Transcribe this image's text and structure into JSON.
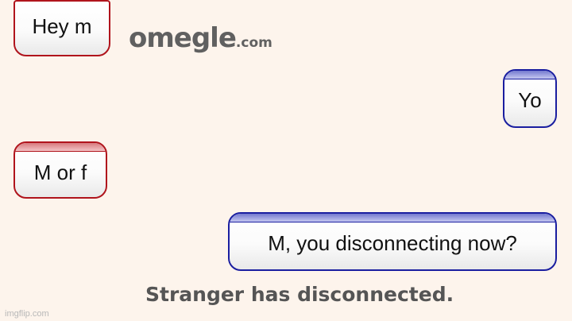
{
  "logo": {
    "name": "omegle",
    "domain": ".com"
  },
  "messages": [
    {
      "from": "stranger",
      "text": "Hey m"
    },
    {
      "from": "you",
      "text": "Yo"
    },
    {
      "from": "stranger",
      "text": "M or f"
    },
    {
      "from": "you",
      "text": "M, you disconnecting now?"
    }
  ],
  "status": "Stranger has disconnected.",
  "watermark": "imgflip.com",
  "colors": {
    "background": "#fdf4ec",
    "stranger": "#b0141c",
    "you": "#1a1ea0",
    "status_text": "#555555"
  }
}
